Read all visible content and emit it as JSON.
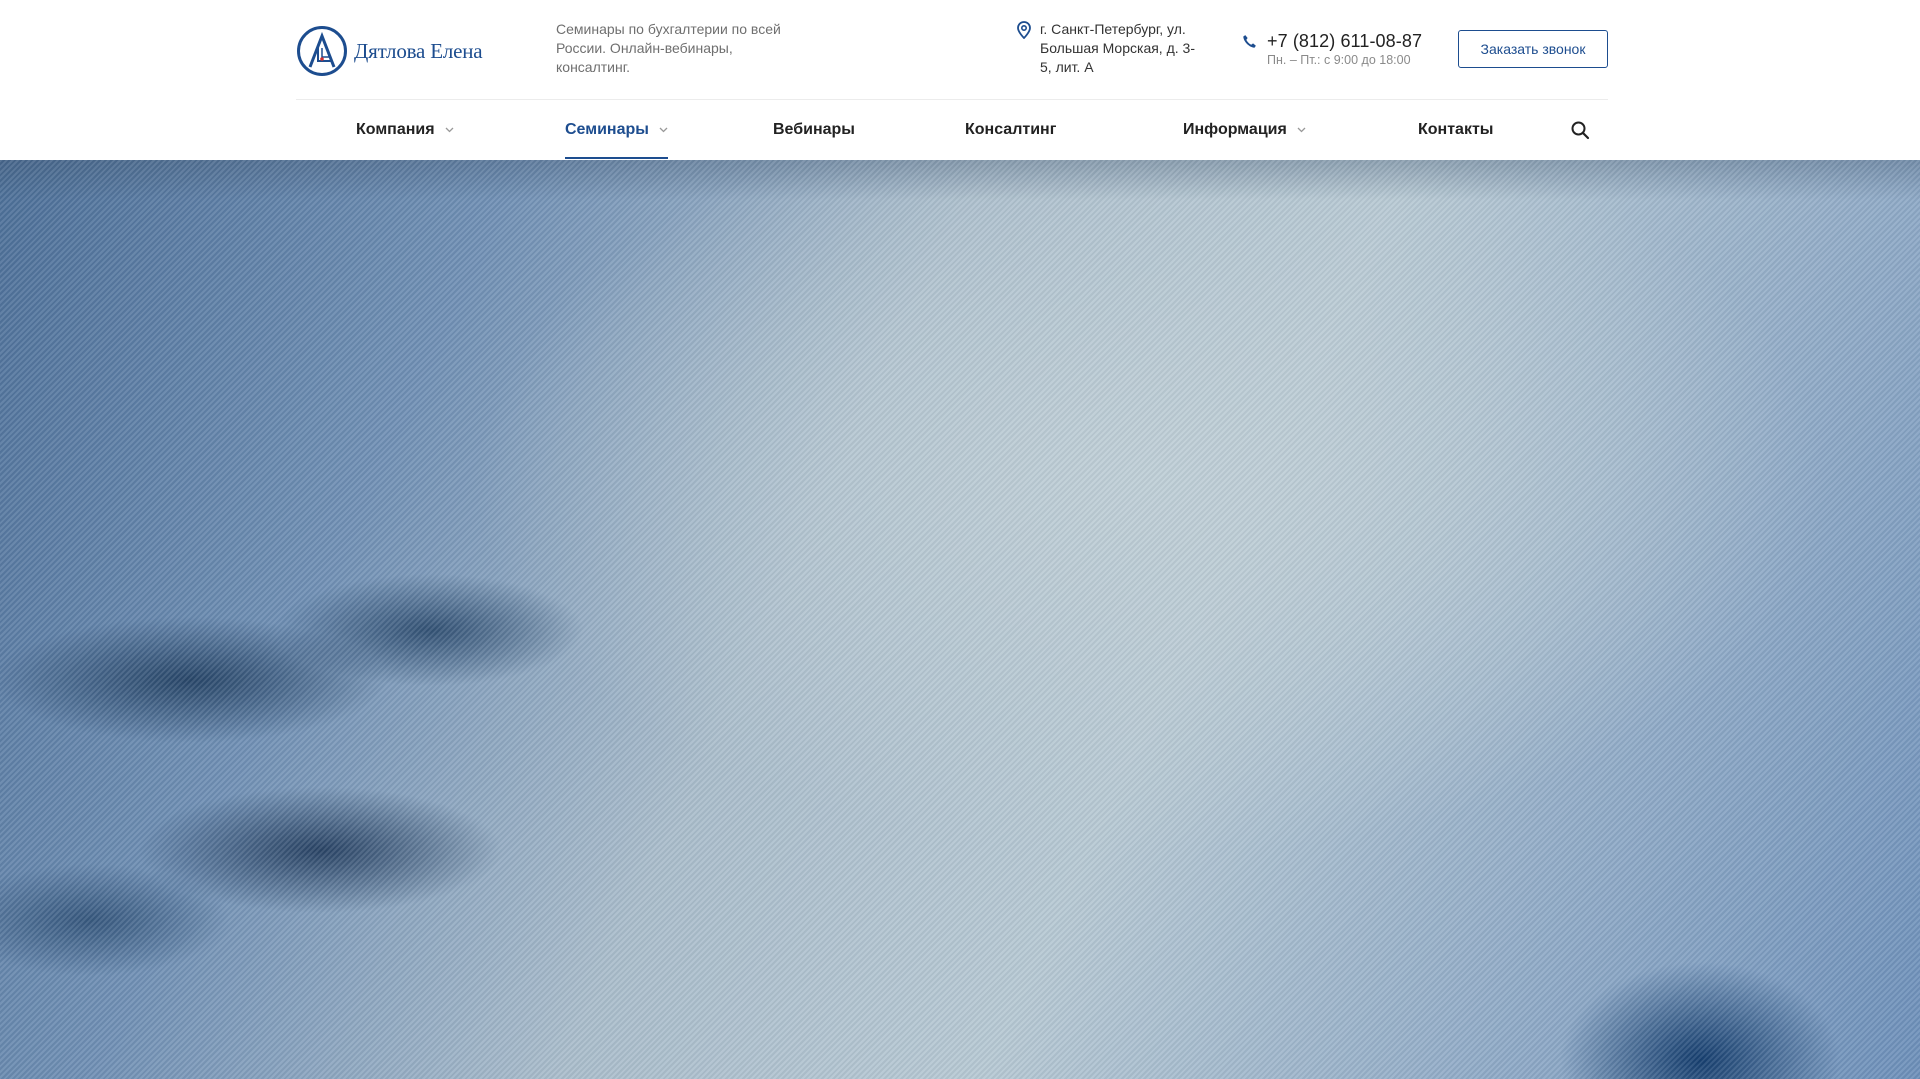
{
  "brand": {
    "name": "Дятлова Елена",
    "tagline": "Семинары по бухгалтерии по всей России. Онлайн-вебинары, консалтинг."
  },
  "contacts": {
    "address": "г. Санкт-Петербург, ул. Большая Морская, д. 3-5, лит. А",
    "phone": "+7 (812) 611-08-87",
    "hours": "Пн. – Пт.: с 9:00 до 18:00",
    "callback_label": "Заказать звонок"
  },
  "nav": {
    "items": [
      {
        "label": "Компания",
        "has_dropdown": true,
        "active": false
      },
      {
        "label": "Семинары",
        "has_dropdown": true,
        "active": true
      },
      {
        "label": "Вебинары",
        "has_dropdown": false,
        "active": false
      },
      {
        "label": "Консалтинг",
        "has_dropdown": false,
        "active": false
      },
      {
        "label": "Информация",
        "has_dropdown": true,
        "active": false
      },
      {
        "label": "Контакты",
        "has_dropdown": false,
        "active": false
      }
    ],
    "search_icon": "search-icon"
  },
  "colors": {
    "brand": "#1d4d8f",
    "accent_red": "#d32f2f",
    "text": "#222222",
    "muted": "#6f6f6f"
  }
}
